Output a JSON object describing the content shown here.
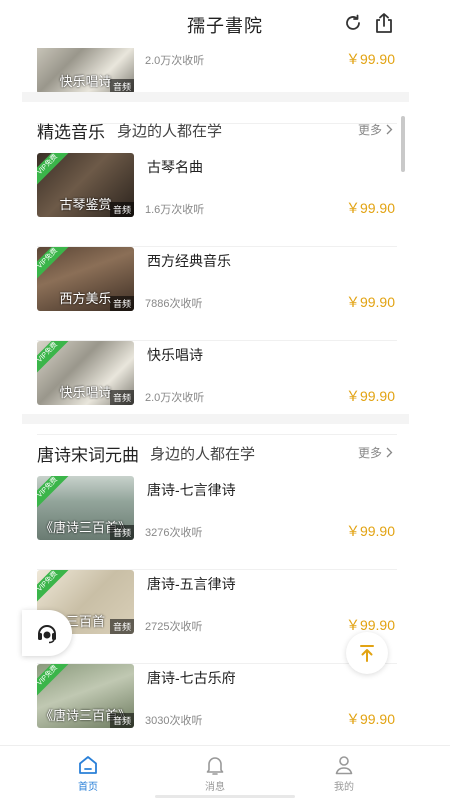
{
  "header": {
    "title": "孺子書院"
  },
  "top_partial": {
    "thumb_title": "快乐唱诗",
    "thumb_tag": "音频",
    "plays": "2.0万次收听",
    "price": "￥99.90"
  },
  "sections": [
    {
      "title": "精选音乐",
      "subtitle": "身边的人都在学",
      "more": "更多",
      "items": [
        {
          "name": "古琴名曲",
          "thumb_title": "古琴鉴赏",
          "vip": "VIP免费",
          "tag": "音频",
          "plays": "1.6万次收听",
          "price": "￥99.90"
        },
        {
          "name": "西方经典音乐",
          "thumb_title": "西方美乐",
          "vip": "VIP免费",
          "tag": "音频",
          "plays": "7886次收听",
          "price": "￥99.90"
        },
        {
          "name": "快乐唱诗",
          "thumb_title": "快乐唱诗",
          "vip": "VIP免费",
          "tag": "音频",
          "plays": "2.0万次收听",
          "price": "￥99.90"
        }
      ]
    },
    {
      "title": "唐诗宋词元曲",
      "subtitle": "身边的人都在学",
      "more": "更多",
      "items": [
        {
          "name": "唐诗-七言律诗",
          "thumb_title": "《唐诗三百首》",
          "vip": "VIP免费",
          "tag": "音频",
          "plays": "3276次收听",
          "price": "￥99.90"
        },
        {
          "name": "唐诗-五言律诗",
          "thumb_title": "三百首",
          "vip": "VIP免费",
          "tag": "音频",
          "plays": "2725次收听",
          "price": "￥99.90"
        },
        {
          "name": "唐诗-七古乐府",
          "thumb_title": "《唐诗三百首》",
          "vip": "VIP免费",
          "tag": "音频",
          "plays": "3030次收听",
          "price": "￥99.90"
        }
      ]
    }
  ],
  "tabbar": [
    {
      "label": "首页",
      "icon": "home-icon",
      "active": true
    },
    {
      "label": "消息",
      "icon": "bell-icon",
      "active": false
    },
    {
      "label": "我的",
      "icon": "user-icon",
      "active": false
    }
  ],
  "colors": {
    "price": "#e2a313",
    "active_tab": "#2a80d8",
    "vip_badge": "#3bb54a"
  }
}
